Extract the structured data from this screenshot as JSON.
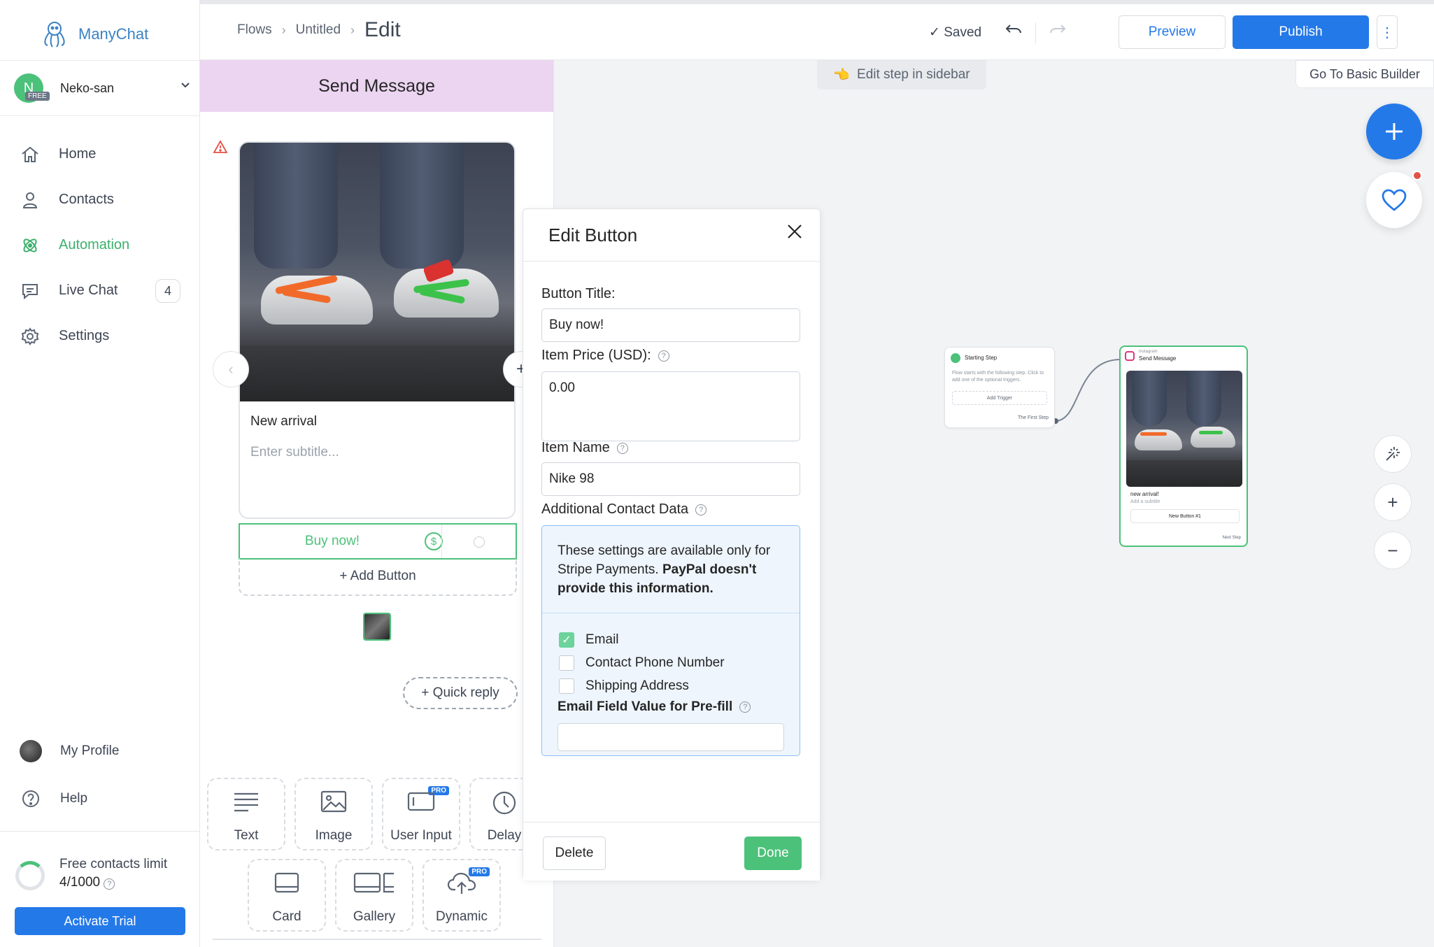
{
  "app": {
    "name": "ManyChat"
  },
  "account": {
    "initial": "N",
    "badge": "FREE",
    "name": "Neko-san"
  },
  "nav": {
    "home": "Home",
    "contacts": "Contacts",
    "automation": "Automation",
    "live_chat": "Live Chat",
    "live_chat_count": "4",
    "settings": "Settings"
  },
  "sidebar_bottom": {
    "profile": "My Profile",
    "help": "Help"
  },
  "limits": {
    "label": "Free contacts limit",
    "value": "4/1000",
    "activate": "Activate Trial"
  },
  "breadcrumb": {
    "flows": "Flows",
    "untitled": "Untitled",
    "edit": "Edit"
  },
  "toolbar": {
    "saved": "Saved",
    "preview": "Preview",
    "publish": "Publish"
  },
  "panel": {
    "header": "Send Message",
    "card_title": "New arrival",
    "card_subtitle_placeholder": "Enter subtitle...",
    "button_label": "Buy now!",
    "add_button": "+ Add Button",
    "quick_reply": "+ Quick reply",
    "blocks": {
      "text": "Text",
      "image": "Image",
      "user_input": "User Input",
      "delay": "Delay",
      "card": "Card",
      "gallery": "Gallery",
      "dynamic": "Dynamic",
      "pro": "PRO"
    }
  },
  "canvas": {
    "hint": "Edit step in sidebar",
    "basic_builder": "Go To Basic Builder",
    "start_node": {
      "title": "Starting Step",
      "desc": "Flow starts with the following step. Click to add one of the optional triggers.",
      "trigger": "Add Trigger",
      "first": "The First Step"
    },
    "msg_node": {
      "channel": "Instagram",
      "title": "Send Message",
      "card_title": "new arrival!",
      "subtitle": "Add a subtitle",
      "button": "New Button #1",
      "next": "Next Step"
    }
  },
  "modal": {
    "title": "Edit Button",
    "button_title_label": "Button Title:",
    "button_title_value": "Buy now!",
    "price_label": "Item Price (USD):",
    "price_value": "0.00",
    "item_name_label": "Item Name",
    "item_name_value": "Nike 98",
    "additional_label": "Additional Contact Data",
    "info_text": "These settings are available only for Stripe Payments.",
    "info_bold": "PayPal doesn't provide this information.",
    "checks": {
      "email": "Email",
      "email_checked": true,
      "phone": "Contact Phone Number",
      "shipping": "Shipping Address"
    },
    "prefill_label": "Email Field Value for Pre-fill",
    "delete": "Delete",
    "done": "Done"
  },
  "colors": {
    "brand_blue": "#2479e8",
    "brand_green": "#4cc17a",
    "header_purple": "#ebd5f0"
  }
}
